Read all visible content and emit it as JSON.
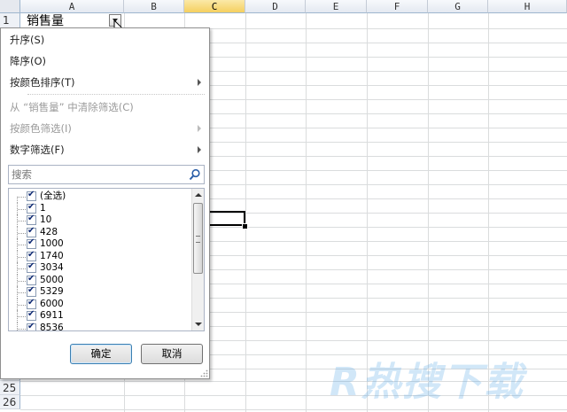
{
  "sheet": {
    "columns": [
      "A",
      "B",
      "C",
      "D",
      "E",
      "F",
      "G",
      "H"
    ],
    "selected_column": "C",
    "rows": [
      {
        "num": "1",
        "label": "1"
      },
      {
        "num": "25",
        "label": "25"
      },
      {
        "num": "26",
        "label": "26"
      }
    ],
    "cell_a1": "销售量"
  },
  "filter_menu": {
    "items": [
      {
        "label": "升序(S)",
        "disabled": false,
        "has_submenu": false
      },
      {
        "label": "降序(O)",
        "disabled": false,
        "has_submenu": false
      },
      {
        "label": "按颜色排序(T)",
        "disabled": false,
        "has_submenu": true
      },
      {
        "label": "从 “销售量” 中清除筛选(C)",
        "disabled": true,
        "has_submenu": false
      },
      {
        "label": "按颜色筛选(I)",
        "disabled": true,
        "has_submenu": true
      },
      {
        "label": "数字筛选(F)",
        "disabled": false,
        "has_submenu": true
      }
    ],
    "search_placeholder": "搜索",
    "values": [
      "(全选)",
      "1",
      "10",
      "428",
      "1000",
      "1740",
      "3034",
      "5000",
      "5329",
      "6000",
      "6911",
      "8536"
    ],
    "ok_label": "确定",
    "cancel_label": "取消"
  },
  "watermark": "R热搜下载",
  "colors": {
    "selected_column_header": "#f5cf5f",
    "grid_line": "#dadcdd",
    "checkmark": "#0f2a74",
    "ok_button_border": "#3c7fb1",
    "watermark": "#5aaae6"
  },
  "icons": [
    "dropdown-arrow-icon",
    "cursor-icon",
    "submenu-arrow-icon",
    "search-icon",
    "checkbox-checked-icon",
    "scroll-up-icon",
    "scroll-down-icon",
    "resize-grip-icon"
  ]
}
